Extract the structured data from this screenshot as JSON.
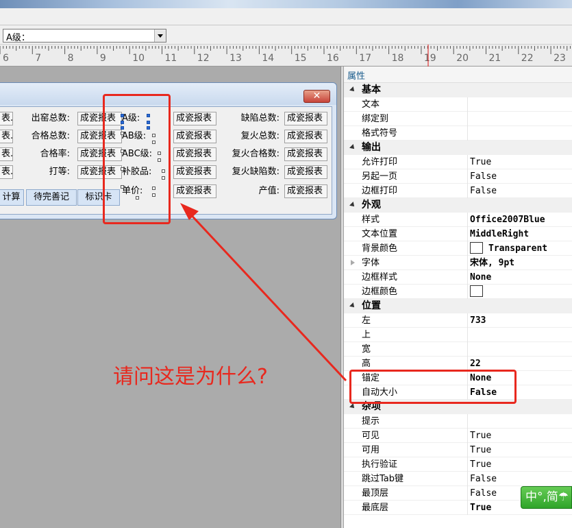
{
  "toolbar": {
    "combo_value": "A级："
  },
  "ruler": {
    "labels": [
      "6",
      "7",
      "8",
      "9",
      "10",
      "11",
      "12",
      "13",
      "14",
      "15",
      "16",
      "17",
      "18",
      "19",
      "20",
      "21",
      "22",
      "23"
    ]
  },
  "form": {
    "labels_col1": [
      "表.",
      "表.",
      "表.",
      "表."
    ],
    "labels_col2": [
      "出窑总数:",
      "合格总数:",
      "合格率:",
      "打等:"
    ],
    "fields_col2": [
      "成瓷报表",
      "成瓷报表",
      "成瓷报表",
      "成瓷报表"
    ],
    "labels_col3": [
      "A级:",
      "AB级:",
      "ABC级:",
      "补胶品:",
      "单价:"
    ],
    "fields_col4": [
      "成瓷报表",
      "成瓷报表",
      "成瓷报表",
      "成瓷报表",
      "成瓷报表"
    ],
    "labels_col5": [
      "缺陷总数:",
      "复火总数:",
      "复火合格数:",
      "复火缺陷数:",
      "产值:"
    ],
    "fields_col6": [
      "成瓷报表",
      "成瓷报表",
      "成瓷报表",
      "成瓷报表",
      "成瓷报表"
    ],
    "tabs": [
      "计算",
      "待完善记",
      "标识卡"
    ],
    "close_label": "✕"
  },
  "annotation": {
    "question": "请问这是为什么?"
  },
  "properties": {
    "title": "属性",
    "categories": [
      {
        "name": "基本",
        "rows": [
          {
            "name": "文本",
            "value": ""
          },
          {
            "name": "绑定到",
            "value": ""
          },
          {
            "name": "格式符号",
            "value": ""
          }
        ]
      },
      {
        "name": "输出",
        "rows": [
          {
            "name": "允许打印",
            "value": "True"
          },
          {
            "name": "另起一页",
            "value": "False"
          },
          {
            "name": "边框打印",
            "value": "False"
          }
        ]
      },
      {
        "name": "外观",
        "rows": [
          {
            "name": "样式",
            "value": "Office2007Blue"
          },
          {
            "name": "文本位置",
            "value": "MiddleRight"
          },
          {
            "name": "背景颜色",
            "value": "Transparent"
          },
          {
            "name": "字体",
            "value": "宋体, 9pt"
          },
          {
            "name": "边框样式",
            "value": "None"
          },
          {
            "name": "边框颜色",
            "value": ""
          }
        ]
      },
      {
        "name": "位置",
        "rows": [
          {
            "name": "左",
            "value": "733"
          },
          {
            "name": "上",
            "value": ""
          },
          {
            "name": "宽",
            "value": ""
          },
          {
            "name": "高",
            "value": "22"
          },
          {
            "name": "锚定",
            "value": "None"
          },
          {
            "name": "自动大小",
            "value": "False"
          }
        ]
      },
      {
        "name": "杂项",
        "rows": [
          {
            "name": "提示",
            "value": ""
          },
          {
            "name": "可见",
            "value": "True"
          },
          {
            "name": "可用",
            "value": "True"
          },
          {
            "name": "执行验证",
            "value": "True"
          },
          {
            "name": "跳过Tab键",
            "value": "False"
          },
          {
            "name": "最顶层",
            "value": "False"
          },
          {
            "name": "最底层",
            "value": "True"
          }
        ]
      }
    ]
  },
  "ime": {
    "label": "中°,简☂"
  },
  "colors": {
    "annotation": "#e8281e",
    "canvas": "#ababab"
  }
}
